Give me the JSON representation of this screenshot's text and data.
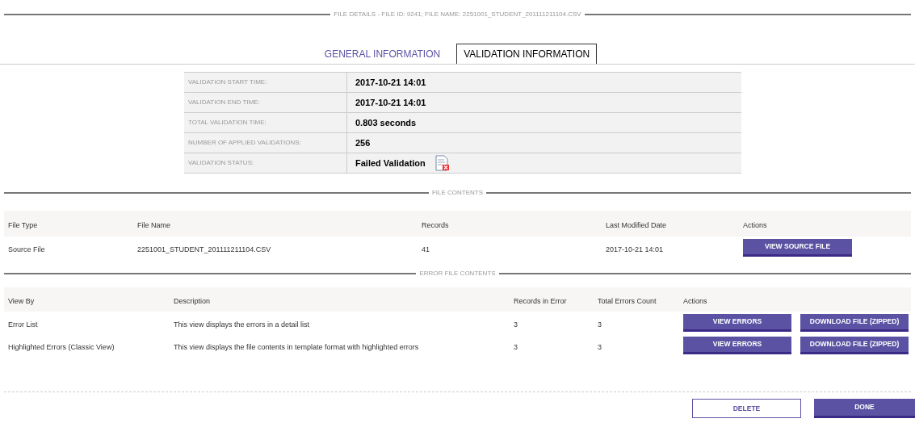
{
  "header": {
    "title": "FILE DETAILS - FILE ID: 9241; FILE NAME: 2251001_STUDENT_201111211104.CSV"
  },
  "tabs": [
    {
      "label": "GENERAL INFORMATION",
      "selected": false
    },
    {
      "label": "VALIDATION INFORMATION",
      "selected": true
    }
  ],
  "validation": [
    {
      "label": "VALIDATION START TIME:",
      "value": "2017-10-21 14:01"
    },
    {
      "label": "VALIDATION END TIME:",
      "value": "2017-10-21 14:01"
    },
    {
      "label": "TOTAL VALIDATION TIME:",
      "value": "0.803 seconds"
    },
    {
      "label": "NUMBER OF APPLIED VALIDATIONS:",
      "value": "256"
    },
    {
      "label": "VALIDATION STATUS:",
      "value": "Failed Validation",
      "failed": true
    }
  ],
  "file_contents": {
    "title": "FILE CONTENTS",
    "columns": [
      "File Type",
      "File Name",
      "Records",
      "Last Modified Date",
      "Actions"
    ],
    "rows": [
      {
        "cells": [
          "Source File",
          "2251001_STUDENT_201111211104.CSV",
          "41",
          "2017-10-21 14:01"
        ],
        "actions": [
          "VIEW SOURCE FILE"
        ]
      }
    ]
  },
  "error_contents": {
    "title": "ERROR FILE CONTENTS",
    "columns": [
      "View By",
      "Description",
      "Records in Error",
      "Total Errors Count",
      "Actions"
    ],
    "rows": [
      {
        "cells": [
          "Error List",
          "This view displays the errors in a detail list",
          "3",
          "3"
        ],
        "actions": [
          "VIEW ERRORS",
          "DOWNLOAD FILE (ZIPPED)"
        ]
      },
      {
        "cells": [
          "Highlighted Errors (Classic View)",
          "This view displays the file contents in template format with highlighted errors",
          "3",
          "3"
        ],
        "actions": [
          "VIEW ERRORS",
          "DOWNLOAD FILE (ZIPPED)"
        ]
      }
    ]
  },
  "footer": {
    "buttons": [
      {
        "label": "DELETE",
        "kind": "secondary"
      },
      {
        "label": "DONE",
        "kind": "primary"
      }
    ]
  }
}
